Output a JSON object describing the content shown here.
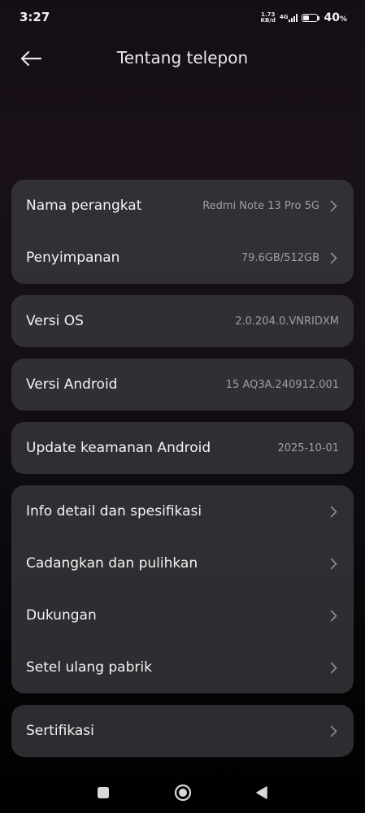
{
  "status_bar": {
    "time": "3:27",
    "net_speed_value": "1.73",
    "net_speed_unit": "KB/d",
    "network_type": "4G",
    "battery_level": 0.4,
    "battery_percent": "40",
    "battery_percent_sign": "%"
  },
  "header": {
    "title": "Tentang telepon",
    "back_icon": "arrow-left-icon"
  },
  "sections": {
    "device": {
      "name_label": "Nama perangkat",
      "name_value": "Redmi Note 13 Pro 5G",
      "storage_label": "Penyimpanan",
      "storage_value": "79.6GB/512GB"
    },
    "os": {
      "label": "Versi OS",
      "value": "2.0.204.0.VNRIDXM"
    },
    "android": {
      "label": "Versi Android",
      "value": "15 AQ3A.240912.001"
    },
    "security": {
      "label": "Update keamanan Android",
      "value": "2025-10-01"
    },
    "more": {
      "info_label": "Info detail dan spesifikasi",
      "backup_label": "Cadangkan dan pulihkan",
      "support_label": "Dukungan",
      "reset_label": "Setel ulang pabrik"
    },
    "cert": {
      "label": "Sertifikasi"
    }
  },
  "nav_bar": {
    "recents_icon": "square-icon",
    "home_icon": "circle-icon",
    "back_icon": "triangle-back-icon"
  },
  "colors": {
    "card": "#3a383e",
    "value_text": "#9e9ea4",
    "chevron": "#8d8d92"
  }
}
